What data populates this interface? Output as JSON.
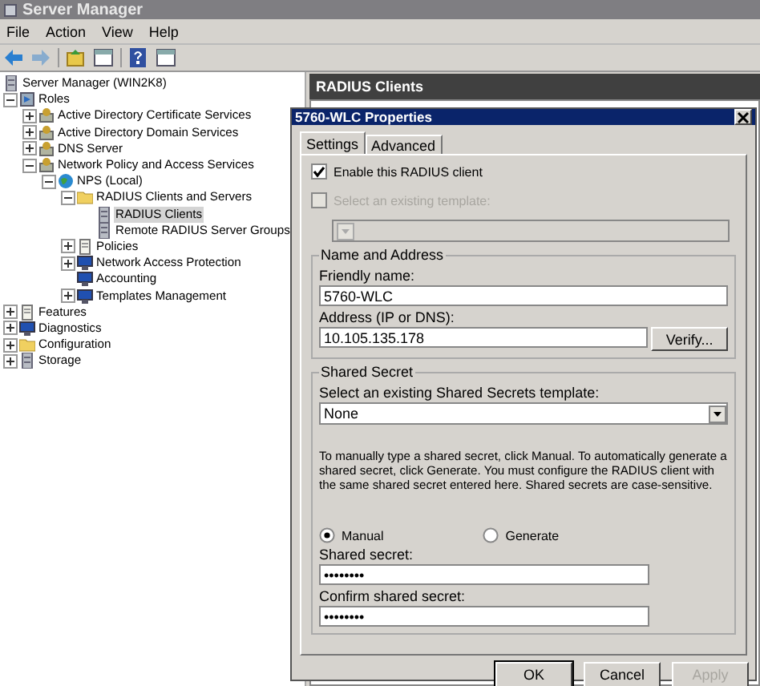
{
  "window": {
    "title": "Server Manager"
  },
  "menu": [
    "File",
    "Action",
    "View",
    "Help"
  ],
  "toolbar": [
    {
      "kind": "back",
      "disabled": false
    },
    {
      "kind": "forward",
      "disabled": true
    },
    {
      "kind": "up",
      "disabled": false
    },
    {
      "kind": "pane",
      "disabled": false
    },
    {
      "kind": "help",
      "disabled": false
    },
    {
      "kind": "pane",
      "disabled": false
    }
  ],
  "tree": {
    "label": "Server Manager (WIN2K8)",
    "kind": "server",
    "children": [
      {
        "label": "Roles",
        "kind": "roles",
        "expanded": true,
        "selected": false,
        "children": [
          {
            "label": "Active Directory Certificate Services",
            "kind": "role",
            "expanded": false,
            "selected": false
          },
          {
            "label": "Active Directory Domain Services",
            "kind": "role",
            "expanded": false,
            "selected": false
          },
          {
            "label": "DNS Server",
            "kind": "role",
            "expanded": false,
            "selected": false
          },
          {
            "label": "Network Policy and Access Services",
            "kind": "role",
            "expanded": true,
            "selected": false,
            "children": [
              {
                "label": "NPS (Local)",
                "kind": "globe",
                "expanded": true,
                "selected": false,
                "children": [
                  {
                    "label": "RADIUS Clients and Servers",
                    "kind": "folder",
                    "expanded": true,
                    "selected": false,
                    "children": [
                      {
                        "label": "RADIUS Clients",
                        "kind": "server",
                        "selected": true
                      },
                      {
                        "label": "Remote RADIUS Server Groups",
                        "kind": "server",
                        "selected": false
                      }
                    ]
                  },
                  {
                    "label": "Policies",
                    "kind": "doc",
                    "expanded": false,
                    "selected": false
                  },
                  {
                    "label": "Network Access Protection",
                    "kind": "monitor",
                    "expanded": false,
                    "selected": false
                  },
                  {
                    "label": "Accounting",
                    "kind": "monitor",
                    "selected": false
                  },
                  {
                    "label": "Templates Management",
                    "kind": "monitor",
                    "expanded": false,
                    "selected": false
                  }
                ]
              }
            ]
          }
        ]
      },
      {
        "label": "Features",
        "kind": "doc",
        "expanded": false,
        "selected": false
      },
      {
        "label": "Diagnostics",
        "kind": "monitor",
        "expanded": false,
        "selected": false
      },
      {
        "label": "Configuration",
        "kind": "folder",
        "expanded": false,
        "selected": false
      },
      {
        "label": "Storage",
        "kind": "server",
        "expanded": false,
        "selected": false
      }
    ]
  },
  "content": {
    "title": "RADIUS Clients"
  },
  "dialog": {
    "title": "5760-WLC Properties",
    "tabs": [
      {
        "label": "Settings",
        "selected": true
      },
      {
        "label": "Advanced",
        "selected": false
      }
    ],
    "enable": {
      "label": "Enable this RADIUS client",
      "checked": true,
      "disabled": false
    },
    "template": {
      "label": "Select an existing template:",
      "checked": false,
      "disabled": true
    },
    "name_group": {
      "title": "Name and Address",
      "friendly_label": "Friendly name:",
      "friendly_value": "5760-WLC",
      "address_label": "Address (IP or DNS):",
      "address_value": "10.105.135.178",
      "verify": "Verify..."
    },
    "secret_group": {
      "title": "Shared Secret",
      "template_label": "Select an existing Shared Secrets template:",
      "template_value": "None",
      "note": "To manually type a shared secret, click Manual. To automatically generate a shared secret, click Generate. You must configure the RADIUS client with the same shared secret entered here. Shared secrets are case-sensitive.",
      "options": [
        {
          "label": "Manual",
          "selected": true
        },
        {
          "label": "Generate",
          "selected": false
        }
      ],
      "secret_label": "Shared secret:",
      "secret_value": "••••••••",
      "confirm_label": "Confirm shared secret:",
      "confirm_value": "••••••••"
    },
    "buttons": [
      {
        "label": "OK",
        "disabled": false,
        "default": true
      },
      {
        "label": "Cancel",
        "disabled": false,
        "default": false
      },
      {
        "label": "Apply",
        "disabled": true,
        "default": false
      }
    ]
  }
}
